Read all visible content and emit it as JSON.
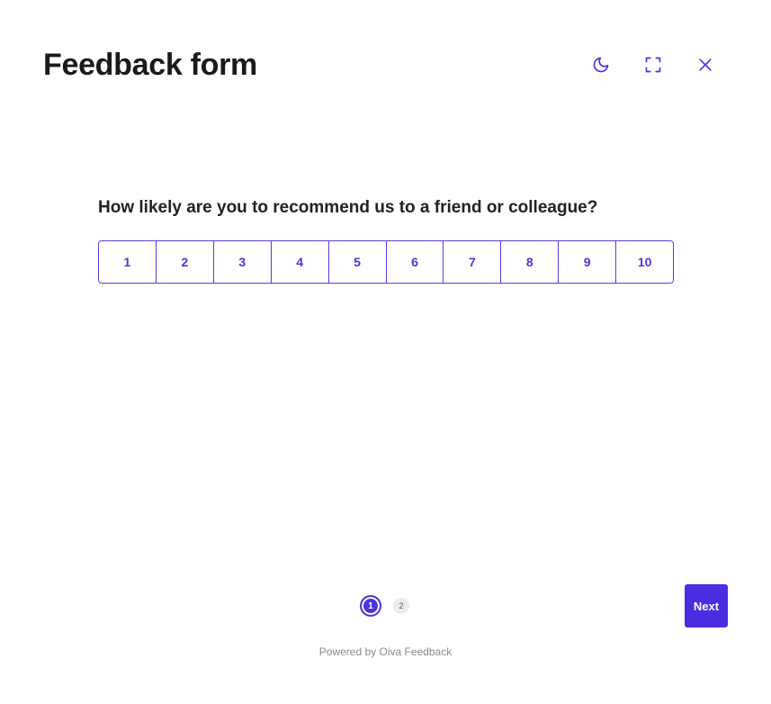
{
  "header": {
    "title": "Feedback form",
    "actions": [
      {
        "name": "dark-mode",
        "icon": "moon-icon"
      },
      {
        "name": "fullscreen",
        "icon": "expand-icon"
      },
      {
        "name": "close",
        "icon": "close-icon"
      }
    ]
  },
  "question": {
    "text": "How likely are you to recommend us to a friend or colleague?",
    "options": [
      "1",
      "2",
      "3",
      "4",
      "5",
      "6",
      "7",
      "8",
      "9",
      "10"
    ]
  },
  "pagination": {
    "pages": [
      "1",
      "2"
    ],
    "current": "1"
  },
  "next_label": "Next",
  "footer": {
    "text": "Powered by Oiva Feedback"
  },
  "colors": {
    "accent": "#4a36d9",
    "button": "#4a2de0",
    "title": "#1a1a1a",
    "muted": "#8a8a8a"
  }
}
